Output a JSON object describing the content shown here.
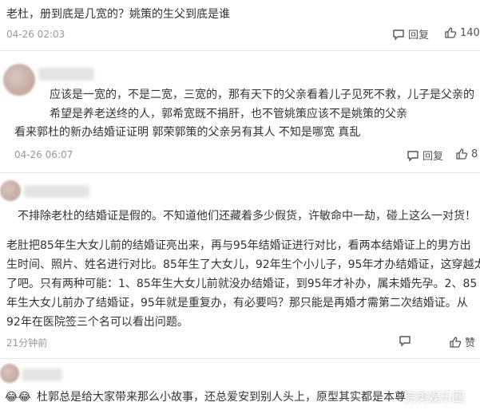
{
  "c1": {
    "title": "老杜，册到底是几宽的？姚策的生父到底是谁",
    "time": "04-26 02:03",
    "reply_label": "回复",
    "like_count": "140"
  },
  "c2": {
    "lines": [
      "应该是一宽的，不是二宽，三宽的，那有天下的父亲看着儿子见死不救，儿子是父亲的",
      "希望是养老送终的人，郭希宽既不捐肝，也不管姚策应该不是姚策的父亲",
      "看来郭杜的新办结婚证证明 郭荣郭策的父亲另有其人 不知是哪宽 真乱"
    ],
    "time": "04-26 06:07",
    "reply_label": "回复",
    "like_count": "8"
  },
  "c3": {
    "line1": "不排除老杜的结婚证是假的。不知道他们还藏着多少假货，许敏命中一劫，碰上这么一对货！",
    "body": [
      "老肚把85年生大女儿前的结婚证亮出来，再与95年结婚证进行对比，看两本结婚证上的男方出",
      "生时间、照片、姓名进行对比。85年生了大女儿，92年生个小儿子，95年才办结婚证，这穿越太",
      "了吧。只有两种可能：1、85年生大女儿前就没办结婚证，到95年才补办，属未婚先孕。2、85",
      "年生大女儿前办了结婚证，95年就是重复办，有必要吗？那只能是再婚才需第二次结婚证。从",
      "92年在医院签三个名可以看出问题。"
    ],
    "time": "21分钟前",
    "like_label": "赞"
  },
  "c4": {
    "text": "杜郭总是给大家带来那么小故事，还总爱安到别人头上，原型其实都是本尊",
    "emoji": "😂😂"
  },
  "watermark": "完美娱乐圈"
}
